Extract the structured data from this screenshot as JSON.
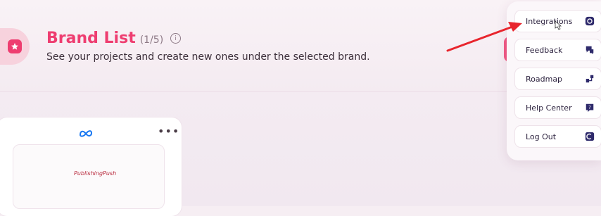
{
  "header": {
    "title": "Brand List",
    "count": "(1/5)",
    "info_glyph": "i",
    "subtitle": "See your projects and create new ones under the selected brand.",
    "brand_icon": "star-icon",
    "accent": "#ee3d70"
  },
  "card": {
    "logo": "meta-logo",
    "more_glyph": "•••",
    "thumb_text": "PublishingPush"
  },
  "menu": {
    "items": [
      {
        "label": "Integrations",
        "icon": "integrations-icon"
      },
      {
        "label": "Feedback",
        "icon": "feedback-icon"
      },
      {
        "label": "Roadmap",
        "icon": "roadmap-icon"
      },
      {
        "label": "Help Center",
        "icon": "help-icon"
      },
      {
        "label": "Log Out",
        "icon": "logout-icon"
      }
    ]
  },
  "annotation": {
    "arrow_color": "#e8252d"
  }
}
